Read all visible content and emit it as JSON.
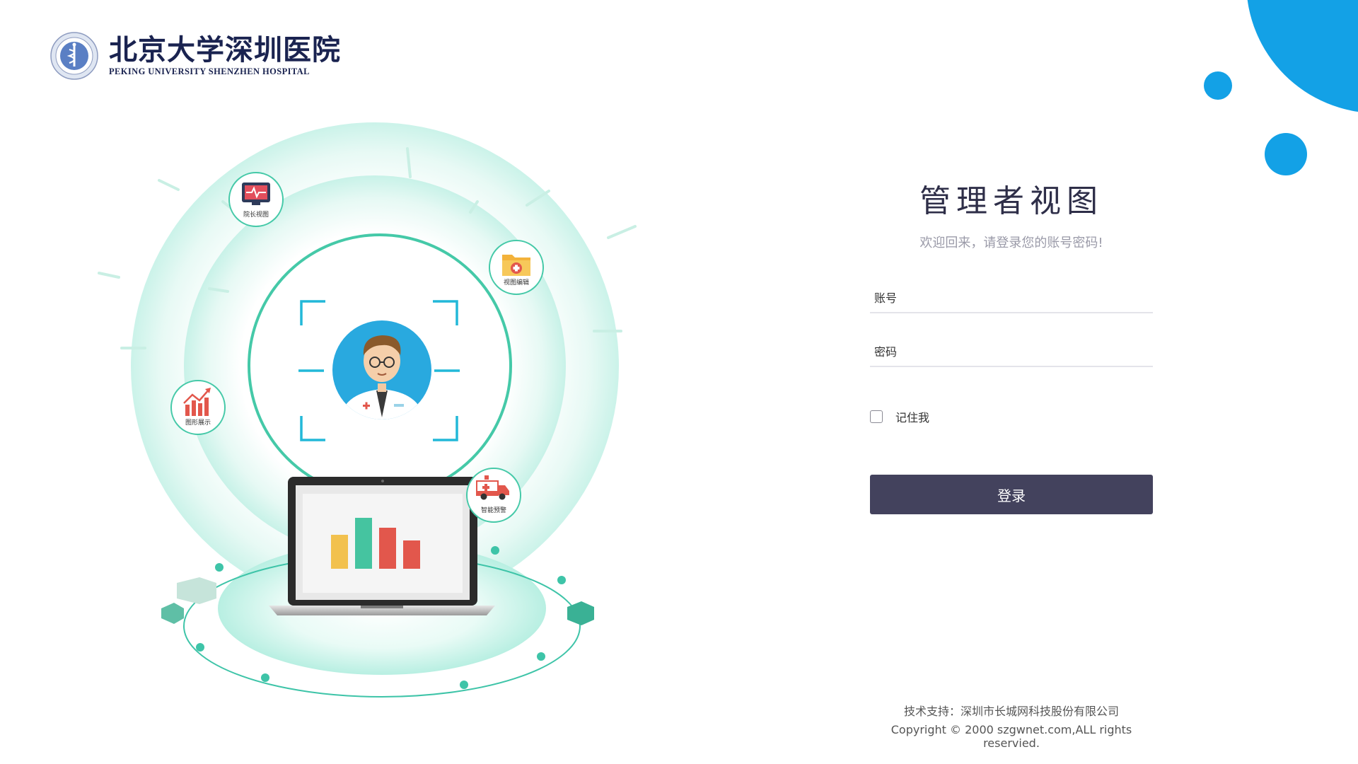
{
  "logo": {
    "name_cn": "北京大学深圳医院",
    "name_en": "PEKING UNIVERSITY SHENZHEN HOSPITAL"
  },
  "illustration": {
    "badges": [
      {
        "label": "院长视图",
        "icon": "monitor-heartbeat-icon"
      },
      {
        "label": "视图编辑",
        "icon": "medical-folder-icon"
      },
      {
        "label": "图形展示",
        "icon": "bar-chart-icon"
      },
      {
        "label": "智能预警",
        "icon": "ambulance-icon"
      }
    ],
    "bar_colors": [
      "#f2c14e",
      "#45c4a0",
      "#e2574c",
      "#e2574c"
    ]
  },
  "login": {
    "title": "管理者视图",
    "subtitle": "欢迎回来，请登录您的账号密码!",
    "account_placeholder": "账号",
    "password_placeholder": "密码",
    "remember_label": "记住我",
    "submit_label": "登录"
  },
  "footer": {
    "support": "技术支持：深圳市长城网科技股份有限公司",
    "copyright": "Copyright © 2000 szgwnet.com,ALL rights reservied."
  },
  "colors": {
    "accent": "#13a1e6",
    "button": "#43425d",
    "teal": "#3ec4a8"
  }
}
